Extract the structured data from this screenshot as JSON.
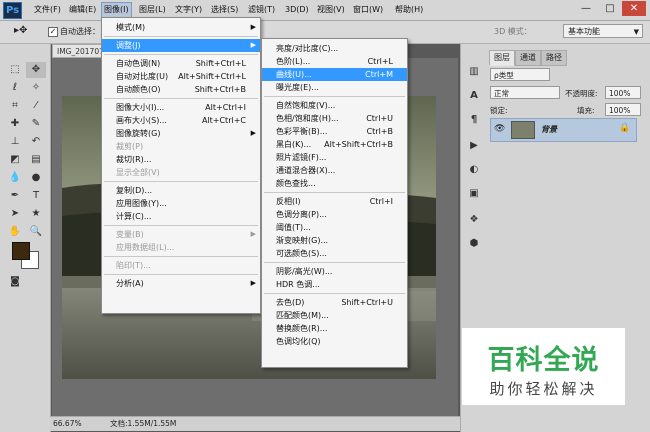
{
  "app": {
    "logo": "Ps"
  },
  "menubar": {
    "items": [
      "文件(F)",
      "编辑(E)",
      "图像(I)",
      "图层(L)",
      "文字(Y)",
      "选择(S)",
      "滤镜(T)",
      "3D(D)",
      "视图(V)",
      "窗口(W)",
      "帮助(H)"
    ],
    "active": "图像(I)"
  },
  "window_controls": {
    "minimize": "—",
    "restore": "□",
    "close": "✕"
  },
  "options": {
    "auto_select_label": "自动选择：",
    "mode3d_label": "3D 模式：",
    "workspace": "基本功能"
  },
  "document": {
    "tab": "IMG_201707",
    "zoom": "66.67%",
    "doc_info": "文档:1.55M/1.55M"
  },
  "image_menu": {
    "items": [
      {
        "label": "模式(M)",
        "shortcut": "",
        "submenu": true,
        "disabled": false,
        "highlighted": false
      },
      {
        "sep": true
      },
      {
        "label": "调整(J)",
        "shortcut": "",
        "submenu": true,
        "disabled": false,
        "highlighted": true
      },
      {
        "sep": true
      },
      {
        "label": "自动色调(N)",
        "shortcut": "Shift+Ctrl+L",
        "submenu": false,
        "disabled": false,
        "highlighted": false
      },
      {
        "label": "自动对比度(U)",
        "shortcut": "Alt+Shift+Ctrl+L",
        "submenu": false,
        "disabled": false,
        "highlighted": false
      },
      {
        "label": "自动颜色(O)",
        "shortcut": "Shift+Ctrl+B",
        "submenu": false,
        "disabled": false,
        "highlighted": false
      },
      {
        "sep": true
      },
      {
        "label": "图像大小(I)...",
        "shortcut": "Alt+Ctrl+I",
        "submenu": false,
        "disabled": false,
        "highlighted": false
      },
      {
        "label": "画布大小(S)...",
        "shortcut": "Alt+Ctrl+C",
        "submenu": false,
        "disabled": false,
        "highlighted": false
      },
      {
        "label": "图像旋转(G)",
        "shortcut": "",
        "submenu": true,
        "disabled": false,
        "highlighted": false
      },
      {
        "label": "裁剪(P)",
        "shortcut": "",
        "submenu": false,
        "disabled": true,
        "highlighted": false
      },
      {
        "label": "裁切(R)...",
        "shortcut": "",
        "submenu": false,
        "disabled": false,
        "highlighted": false
      },
      {
        "label": "显示全部(V)",
        "shortcut": "",
        "submenu": false,
        "disabled": true,
        "highlighted": false
      },
      {
        "sep": true
      },
      {
        "label": "复制(D)...",
        "shortcut": "",
        "submenu": false,
        "disabled": false,
        "highlighted": false
      },
      {
        "label": "应用图像(Y)...",
        "shortcut": "",
        "submenu": false,
        "disabled": false,
        "highlighted": false
      },
      {
        "label": "计算(C)...",
        "shortcut": "",
        "submenu": false,
        "disabled": false,
        "highlighted": false
      },
      {
        "sep": true
      },
      {
        "label": "变量(B)",
        "shortcut": "",
        "submenu": true,
        "disabled": true,
        "highlighted": false
      },
      {
        "label": "应用数据组(L)...",
        "shortcut": "",
        "submenu": false,
        "disabled": true,
        "highlighted": false
      },
      {
        "sep": true
      },
      {
        "label": "陷印(T)...",
        "shortcut": "",
        "submenu": false,
        "disabled": true,
        "highlighted": false
      },
      {
        "sep": true
      },
      {
        "label": "分析(A)",
        "shortcut": "",
        "submenu": true,
        "disabled": false,
        "highlighted": false
      }
    ]
  },
  "adjust_menu": {
    "items": [
      {
        "label": "亮度/对比度(C)...",
        "shortcut": "",
        "highlighted": false
      },
      {
        "label": "色阶(L)...",
        "shortcut": "Ctrl+L",
        "highlighted": false
      },
      {
        "label": "曲线(U)...",
        "shortcut": "Ctrl+M",
        "highlighted": true
      },
      {
        "label": "曝光度(E)...",
        "shortcut": "",
        "highlighted": false
      },
      {
        "sep": true
      },
      {
        "label": "自然饱和度(V)...",
        "shortcut": "",
        "highlighted": false
      },
      {
        "label": "色相/饱和度(H)...",
        "shortcut": "Ctrl+U",
        "highlighted": false
      },
      {
        "label": "色彩平衡(B)...",
        "shortcut": "Ctrl+B",
        "highlighted": false
      },
      {
        "label": "黑白(K)...",
        "shortcut": "Alt+Shift+Ctrl+B",
        "highlighted": false
      },
      {
        "label": "照片滤镜(F)...",
        "shortcut": "",
        "highlighted": false
      },
      {
        "label": "通道混合器(X)...",
        "shortcut": "",
        "highlighted": false
      },
      {
        "label": "颜色查找...",
        "shortcut": "",
        "highlighted": false
      },
      {
        "sep": true
      },
      {
        "label": "反相(I)",
        "shortcut": "Ctrl+I",
        "highlighted": false
      },
      {
        "label": "色调分离(P)...",
        "shortcut": "",
        "highlighted": false
      },
      {
        "label": "阈值(T)...",
        "shortcut": "",
        "highlighted": false
      },
      {
        "label": "渐变映射(G)...",
        "shortcut": "",
        "highlighted": false
      },
      {
        "label": "可选颜色(S)...",
        "shortcut": "",
        "highlighted": false
      },
      {
        "sep": true
      },
      {
        "label": "阴影/高光(W)...",
        "shortcut": "",
        "highlighted": false
      },
      {
        "label": "HDR 色调...",
        "shortcut": "",
        "highlighted": false
      },
      {
        "sep": true
      },
      {
        "label": "去色(D)",
        "shortcut": "Shift+Ctrl+U",
        "highlighted": false
      },
      {
        "label": "匹配颜色(M)...",
        "shortcut": "",
        "highlighted": false
      },
      {
        "label": "替换颜色(R)...",
        "shortcut": "",
        "highlighted": false
      },
      {
        "label": "色调均化(Q)",
        "shortcut": "",
        "highlighted": false
      }
    ]
  },
  "layers_panel": {
    "tabs": [
      "图层",
      "通道",
      "路径"
    ],
    "filter_kind": "ρ类型",
    "blend_mode": "正常",
    "opacity_label": "不透明度:",
    "opacity": "100%",
    "lock_label": "锁定:",
    "fill_label": "填充:",
    "fill": "100%",
    "layer_name": "背景"
  },
  "watermark": {
    "title": "百科全说",
    "subtitle": "助你轻松解决"
  },
  "colors": {
    "highlight": "#3399ff",
    "fg_swatch": "#3d2a0e",
    "watermark_green": "#33a852"
  }
}
